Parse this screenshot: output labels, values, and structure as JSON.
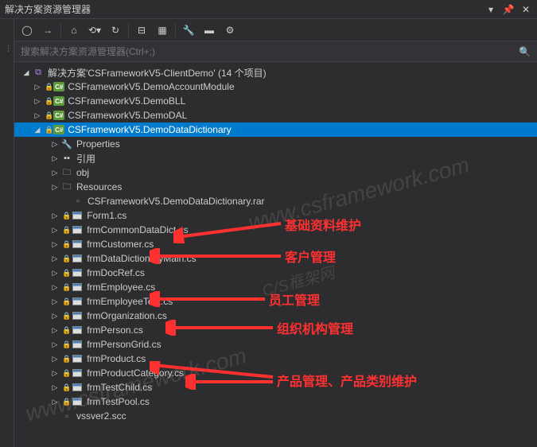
{
  "title": "解决方案资源管理器",
  "search_placeholder": "搜索解决方案资源管理器(Ctrl+;)",
  "solution": {
    "label": "解决方案'CSFrameworkV5-ClientDemo' (14 个项目)"
  },
  "projects": [
    {
      "label": "CSFrameworkV5.DemoAccountModule"
    },
    {
      "label": "CSFrameworkV5.DemoBLL"
    },
    {
      "label": "CSFrameworkV5.DemoDAL"
    },
    {
      "label": "CSFrameworkV5.DemoDataDictionary"
    }
  ],
  "children": {
    "properties": "Properties",
    "references": "引用",
    "obj": "obj",
    "resources": "Resources",
    "rar": "CSFrameworkV5.DemoDataDictionary.rar",
    "files": [
      "Form1.cs",
      "frmCommonDataDict.cs",
      "frmCustomer.cs",
      "frmDataDictionaryMain.cs",
      "frmDocRef.cs",
      "frmEmployee.cs",
      "frmEmployeeTest.cs",
      "frmOrganization.cs",
      "frmPerson.cs",
      "frmPersonGrid.cs",
      "frmProduct.cs",
      "frmProductCategory.cs",
      "frmTestChild.cs",
      "frmTestPool.cs",
      "vssver2.scc"
    ]
  },
  "annotations": {
    "a1": "基础资料维护",
    "a2": "客户管理",
    "a3": "员工管理",
    "a4": "组织机构管理",
    "a5": "产品管理、产品类别维护"
  },
  "watermarks": {
    "w1": "www.csframework.com",
    "w2": "C/S框架网",
    "w3": "www.csframework.com"
  }
}
